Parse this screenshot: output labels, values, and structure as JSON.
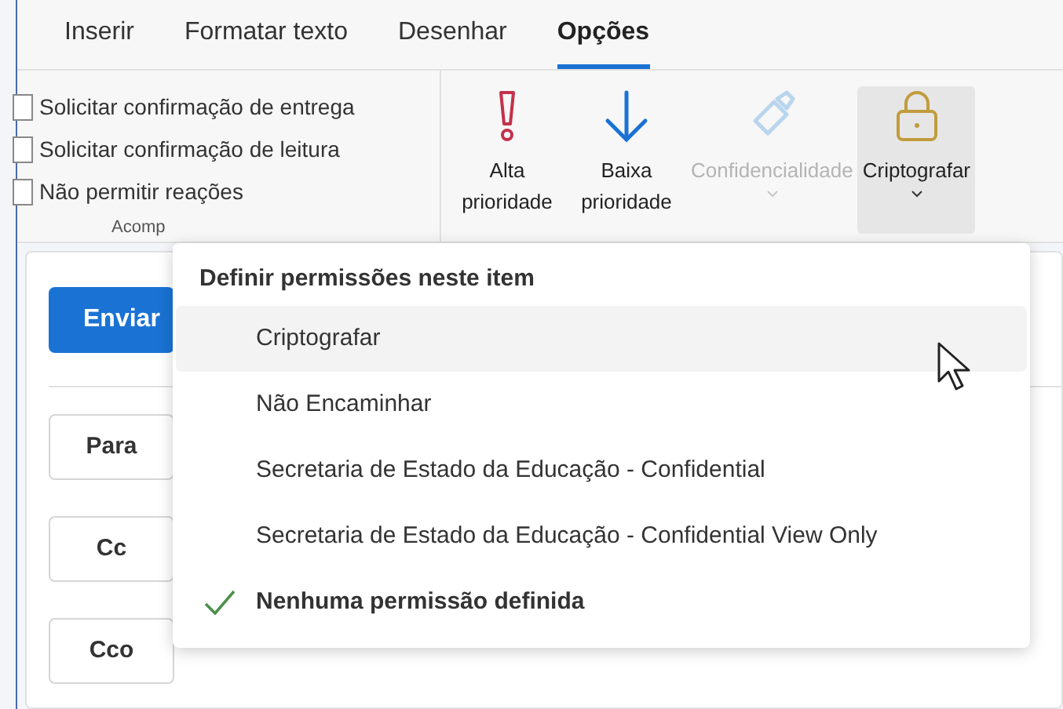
{
  "tabs": [
    {
      "label": "Inserir",
      "selected": false
    },
    {
      "label": "Formatar texto",
      "selected": false
    },
    {
      "label": "Desenhar",
      "selected": false
    },
    {
      "label": "Opções",
      "selected": true
    }
  ],
  "tracking": {
    "checkboxes": [
      {
        "label": "Solicitar confirmação de entrega",
        "checked": false
      },
      {
        "label": "Solicitar confirmação de leitura",
        "checked": false
      },
      {
        "label": "Não permitir reações",
        "checked": false
      }
    ],
    "group_label": "Acomp"
  },
  "ribbon_buttons": [
    {
      "kind": "high",
      "label": "Alta prioridade",
      "disabled": false,
      "expanded": false
    },
    {
      "kind": "low",
      "label": "Baixa prioridade",
      "disabled": false,
      "expanded": false
    },
    {
      "kind": "sensitivity",
      "label": "Confidencialidade",
      "disabled": true,
      "expanded": false,
      "dropdown": true
    },
    {
      "kind": "encrypt",
      "label": "Criptografar",
      "disabled": false,
      "expanded": true,
      "dropdown": true
    }
  ],
  "compose": {
    "send": "Enviar",
    "recipients": [
      "Para",
      "Cc",
      "Cco"
    ]
  },
  "menu": {
    "title": "Definir permissões neste item",
    "items": [
      {
        "label": "Criptografar",
        "hovered": true,
        "checked": false
      },
      {
        "label": "Não Encaminhar",
        "hovered": false,
        "checked": false
      },
      {
        "label": "Secretaria de Estado da Educação - Confidential",
        "hovered": false,
        "checked": false
      },
      {
        "label": "Secretaria de Estado da Educação - Confidential View Only",
        "hovered": false,
        "checked": false
      },
      {
        "label": "Nenhuma permissão definida",
        "hovered": false,
        "checked": true
      }
    ]
  }
}
